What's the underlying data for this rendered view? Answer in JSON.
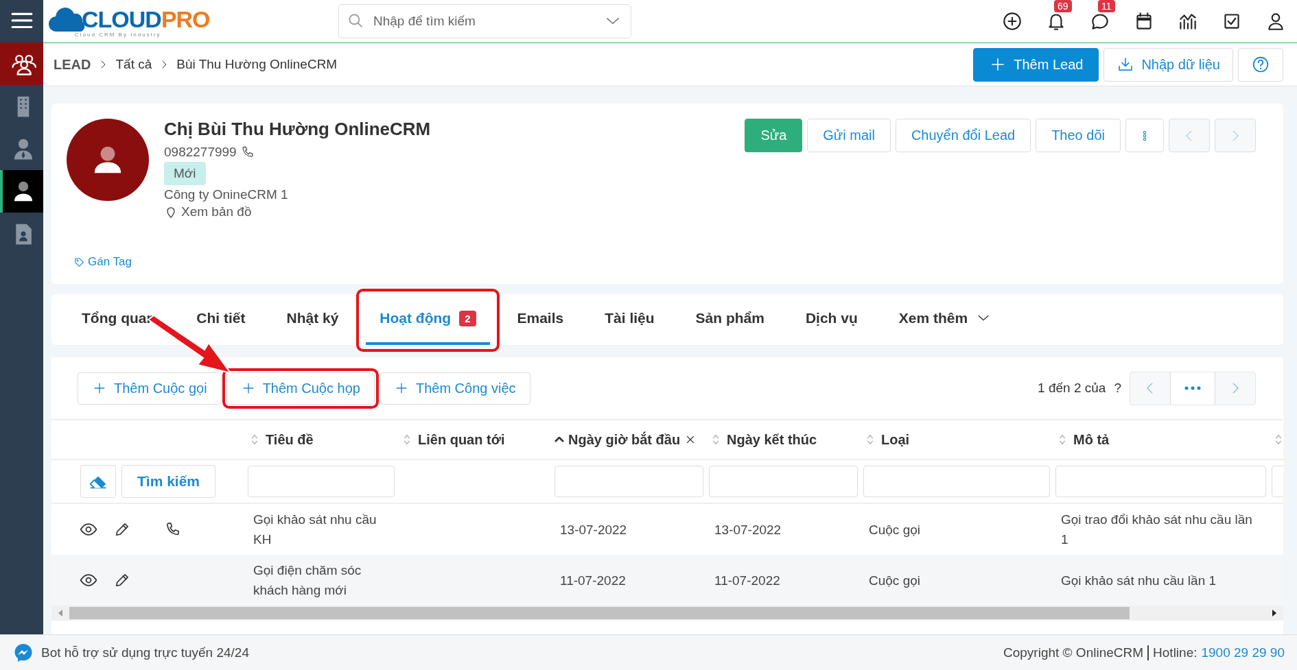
{
  "topbar": {
    "logo_left": "CLOUD",
    "logo_right": "PRO",
    "logo_tagline": "Cloud CRM By Industry",
    "search": {
      "placeholder": "Nhập để tìm kiếm"
    },
    "icons": [
      {
        "kind": "add"
      },
      {
        "kind": "bell",
        "badge": "69"
      },
      {
        "kind": "chat",
        "badge": "11"
      },
      {
        "kind": "calendar"
      },
      {
        "kind": "chart"
      },
      {
        "kind": "check"
      },
      {
        "kind": "user"
      }
    ]
  },
  "sidebar": {
    "items": [
      {
        "kind": "group",
        "selected": false
      },
      {
        "kind": "building",
        "selected": false
      },
      {
        "kind": "contact",
        "selected": false
      },
      {
        "kind": "person",
        "selected": true
      },
      {
        "kind": "document",
        "selected": false
      }
    ]
  },
  "breadcrumb": [
    "LEAD",
    "Tất cả",
    "Bùi Thu Hường OnlineCRM"
  ],
  "header_buttons": [
    {
      "kind": "add",
      "label": "Thêm Lead"
    },
    {
      "kind": "import",
      "label": "Nhập dữ liệu"
    },
    {
      "kind": "help"
    }
  ],
  "profile": {
    "name": "Chị Bùi Thu Hường OnlineCRM",
    "phone": "0982277999",
    "status": "Mới",
    "company": "Công ty OnineCRM 1",
    "map_link": "Xem bản đồ",
    "tag_link": "Gán Tag",
    "actions": [
      {
        "kind": "primary",
        "label": "Sửa"
      },
      {
        "kind": "default",
        "label": "Gửi mail"
      },
      {
        "kind": "default",
        "label": "Chuyển đổi Lead"
      },
      {
        "kind": "default",
        "label": "Theo dõi"
      },
      {
        "kind": "more"
      },
      {
        "kind": "prev",
        "disabled": true
      },
      {
        "kind": "next",
        "disabled": true
      }
    ]
  },
  "tabs": [
    {
      "label": "Tổng quan",
      "selected": false,
      "highlighted": false
    },
    {
      "label": "Chi tiết",
      "selected": false,
      "highlighted": false
    },
    {
      "label": "Nhật ký",
      "selected": false,
      "highlighted": false
    },
    {
      "label": "Hoạt động",
      "badge": "2",
      "selected": true,
      "highlighted": true
    },
    {
      "label": "Emails",
      "selected": false,
      "highlighted": false
    },
    {
      "label": "Tài liệu",
      "selected": false,
      "highlighted": false
    },
    {
      "label": "Sản phẩm",
      "selected": false,
      "highlighted": false
    },
    {
      "label": "Dịch vụ",
      "selected": false,
      "highlighted": false
    },
    {
      "label": "Xem thêm",
      "dropdown": true,
      "selected": false,
      "highlighted": false
    }
  ],
  "activity_buttons": [
    {
      "label": "Thêm Cuộc gọi",
      "highlighted": false
    },
    {
      "label": "Thêm Cuộc họp",
      "highlighted": true
    },
    {
      "label": "Thêm Công việc",
      "highlighted": false
    }
  ],
  "pagination": {
    "range": "1 đến 2 của",
    "total": "?"
  },
  "table": {
    "search_button": "Tìm kiếm",
    "columns": [
      {
        "label": "Tiêu đề",
        "sorted": false,
        "filter": true
      },
      {
        "label": "Liên quan tới",
        "sorted": false,
        "filter": false
      },
      {
        "label": "Ngày giờ bắt đầu",
        "sorted": true,
        "clearable": true,
        "filter": true
      },
      {
        "label": "Ngày kết thúc",
        "sorted": false,
        "filter": true
      },
      {
        "label": "Loại",
        "sorted": false,
        "filter": true
      },
      {
        "label": "Mô tả",
        "sorted": false,
        "filter": true
      }
    ],
    "rows": [
      {
        "call": true,
        "cells": [
          "Gọi khảo sát nhu cầu KH",
          null,
          "13-07-2022",
          "13-07-2022",
          "Cuộc gọi",
          "Gọi trao đổi khảo sát nhu cầu lần 1"
        ]
      },
      {
        "call": false,
        "cells": [
          "Gọi điện chăm sóc khách hàng mới",
          null,
          "11-07-2022",
          "11-07-2022",
          "Cuộc gọi",
          "Gọi khảo sát nhu cầu lần 1"
        ]
      }
    ]
  },
  "footer": {
    "bot_text": "Bot hỗ trợ sử dụng trực tuyến 24/24",
    "copyright": "Copyright © OnlineCRM",
    "hotline_label": "Hotline:",
    "hotline": "1900 29 29 90"
  }
}
